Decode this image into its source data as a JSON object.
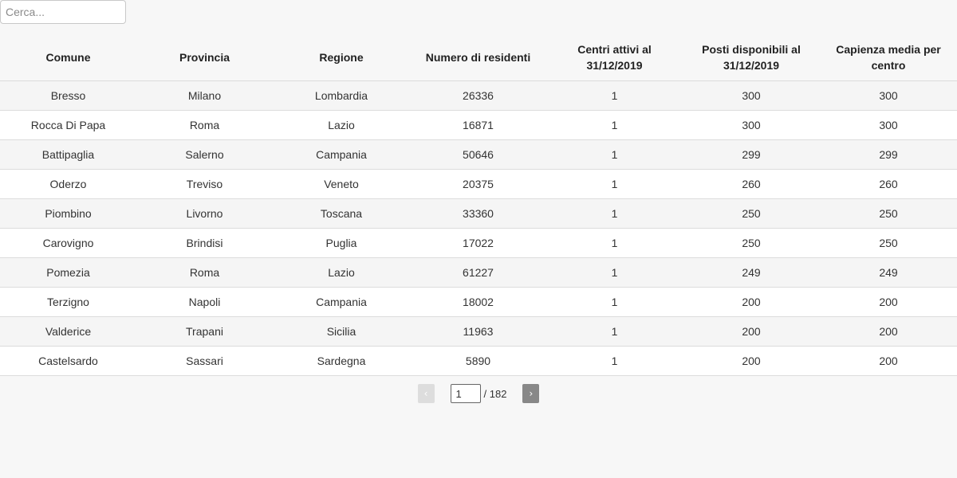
{
  "search": {
    "placeholder": "Cerca..."
  },
  "table": {
    "headers": [
      "Comune",
      "Provincia",
      "Regione",
      "Numero di residenti",
      "Centri attivi al 31/12/2019",
      "Posti disponibili al 31/12/2019",
      "Capienza media per centro"
    ],
    "rows": [
      [
        "Bresso",
        "Milano",
        "Lombardia",
        "26336",
        "1",
        "300",
        "300"
      ],
      [
        "Rocca Di Papa",
        "Roma",
        "Lazio",
        "16871",
        "1",
        "300",
        "300"
      ],
      [
        "Battipaglia",
        "Salerno",
        "Campania",
        "50646",
        "1",
        "299",
        "299"
      ],
      [
        "Oderzo",
        "Treviso",
        "Veneto",
        "20375",
        "1",
        "260",
        "260"
      ],
      [
        "Piombino",
        "Livorno",
        "Toscana",
        "33360",
        "1",
        "250",
        "250"
      ],
      [
        "Carovigno",
        "Brindisi",
        "Puglia",
        "17022",
        "1",
        "250",
        "250"
      ],
      [
        "Pomezia",
        "Roma",
        "Lazio",
        "61227",
        "1",
        "249",
        "249"
      ],
      [
        "Terzigno",
        "Napoli",
        "Campania",
        "18002",
        "1",
        "200",
        "200"
      ],
      [
        "Valderice",
        "Trapani",
        "Sicilia",
        "11963",
        "1",
        "200",
        "200"
      ],
      [
        "Castelsardo",
        "Sassari",
        "Sardegna",
        "5890",
        "1",
        "200",
        "200"
      ]
    ]
  },
  "pagination": {
    "prev_label": "‹",
    "next_label": "›",
    "current_page": "1",
    "total_label": "/ 182"
  }
}
